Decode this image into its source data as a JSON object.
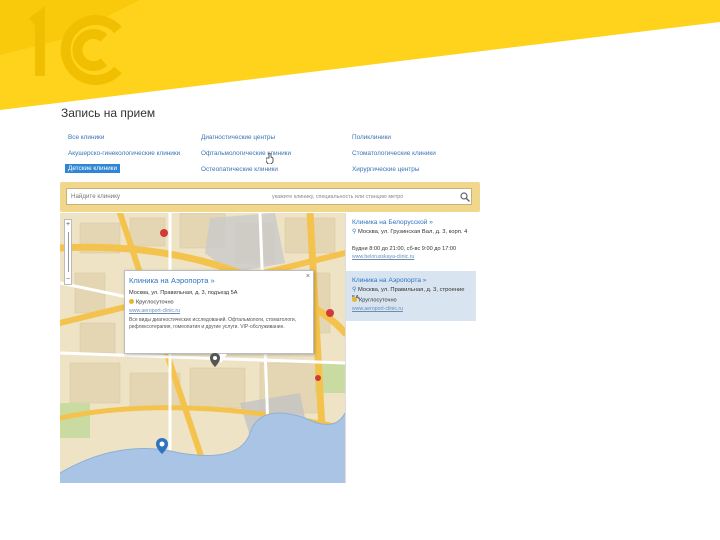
{
  "slide": {
    "brand_color": "#ffd21c",
    "brand_shape_color": "#f5c400"
  },
  "page": {
    "title": "Запись на прием",
    "categories": [
      {
        "label": "Все клиники",
        "active": false
      },
      {
        "label": "Диагностические центры",
        "active": false
      },
      {
        "label": "Поликлиники",
        "active": false
      },
      {
        "label": "Акушерско-гинекологические клиники",
        "active": false
      },
      {
        "label": "Офтальмологические клиники",
        "active": false
      },
      {
        "label": "Стоматологические клиники",
        "active": false
      },
      {
        "label": "Детские клиники",
        "active": true
      },
      {
        "label": "Остеопатические клиники",
        "active": false
      },
      {
        "label": "Хирургические центры",
        "active": false
      }
    ],
    "search": {
      "placeholder": "Найдите клинику",
      "hint": "укажите клинику, специальность или станцию метро",
      "icon": "search-icon"
    },
    "popup": {
      "title": "Клиника на Аэропорта »",
      "address": "Москва, ул. Правильная, д. 3, подъезд 5А",
      "hours": "Круглосуточно",
      "link": "www.aeroport-clinic.ru",
      "description": "Все виды диагностических исследований. Офтальмологи, стоматологи, рефлексотерапия, гомеопатия и другие услуги. VIP-обслуживание.",
      "close": "×"
    },
    "clinics": [
      {
        "name": "Клиника на Белорусской »",
        "address": "Москва, ул. Грузинская Вал, д. 3, корп. 4",
        "hours": "Будни 8:00 до 21:00, сб-вс 9:00 до 17:00",
        "link": "www.belorusskaya-clinic.ru"
      },
      {
        "name": "Клиника на Аэропорта »",
        "address": "Москва, ул. Правильная, д. 3, строение 5А",
        "hours": "Круглосуточно",
        "link": "www.aeroport-clinic.ru"
      }
    ],
    "map": {
      "zoom_in": "+",
      "zoom_out": "−"
    }
  }
}
